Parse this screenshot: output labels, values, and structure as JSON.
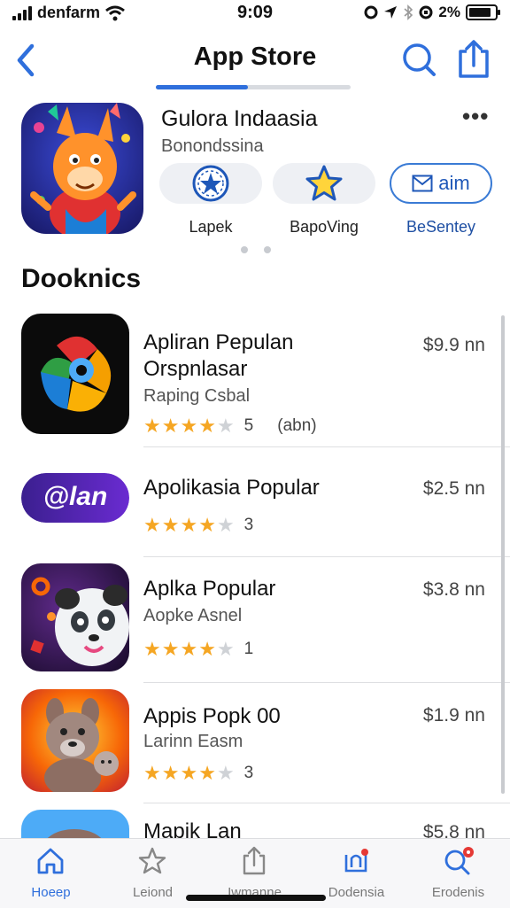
{
  "status_bar": {
    "carrier": "denfarm",
    "time": "9:09",
    "battery_text": "2%"
  },
  "nav": {
    "title": "App Store"
  },
  "featured": {
    "title": "Gulora Indaasia",
    "subtitle": "Bonondssina",
    "more": "•••",
    "pills": [
      {
        "label": "Lapek",
        "icon": "globe-star-icon"
      },
      {
        "label": "BapoVing",
        "icon": "star-icon"
      },
      {
        "label": "BeSentey",
        "button_text": "aim",
        "icon": "mail-icon"
      }
    ]
  },
  "section": {
    "title": "Dooknics"
  },
  "apps": [
    {
      "title_lines": [
        "Apliran Pepulan",
        "Orspnlasar"
      ],
      "subtitle": "Raping Csbal",
      "stars": 4,
      "rating_count": "5",
      "rating_extra": "(abn)",
      "price": "$9.9 nn"
    },
    {
      "title_lines": [
        "Apolikasia Popular"
      ],
      "subtitle": "",
      "stars": 4,
      "rating_count": "3",
      "rating_extra": "",
      "price": "$2.5 nn",
      "icon_text": "@lan"
    },
    {
      "title_lines": [
        "Aplka Popular"
      ],
      "subtitle": "Aopke Asnel",
      "stars": 4,
      "rating_count": "1",
      "rating_extra": "",
      "price": "$3.8 nn"
    },
    {
      "title_lines": [
        "Appis Popk 00"
      ],
      "subtitle": "Larinn Easm",
      "stars": 4,
      "rating_count": "3",
      "rating_extra": "",
      "price": "$1.9 nn"
    },
    {
      "title_lines": [
        "Mapik Lan"
      ],
      "subtitle": "",
      "stars": 0,
      "rating_count": "",
      "rating_extra": "",
      "price": "$5.8 nn"
    }
  ],
  "tabs": [
    {
      "label": "Hoeep",
      "icon": "home-icon",
      "active": true
    },
    {
      "label": "Leiond",
      "icon": "star-icon",
      "active": false
    },
    {
      "label": "Iwmanne",
      "icon": "share-icon",
      "active": false
    },
    {
      "label": "Dodensia",
      "icon": "updates-icon",
      "active": false
    },
    {
      "label": "Erodenis",
      "icon": "search-icon",
      "active": false
    }
  ],
  "colors": {
    "accent": "#2f6fdc",
    "star": "#f5a623",
    "badge": "#e53935"
  }
}
